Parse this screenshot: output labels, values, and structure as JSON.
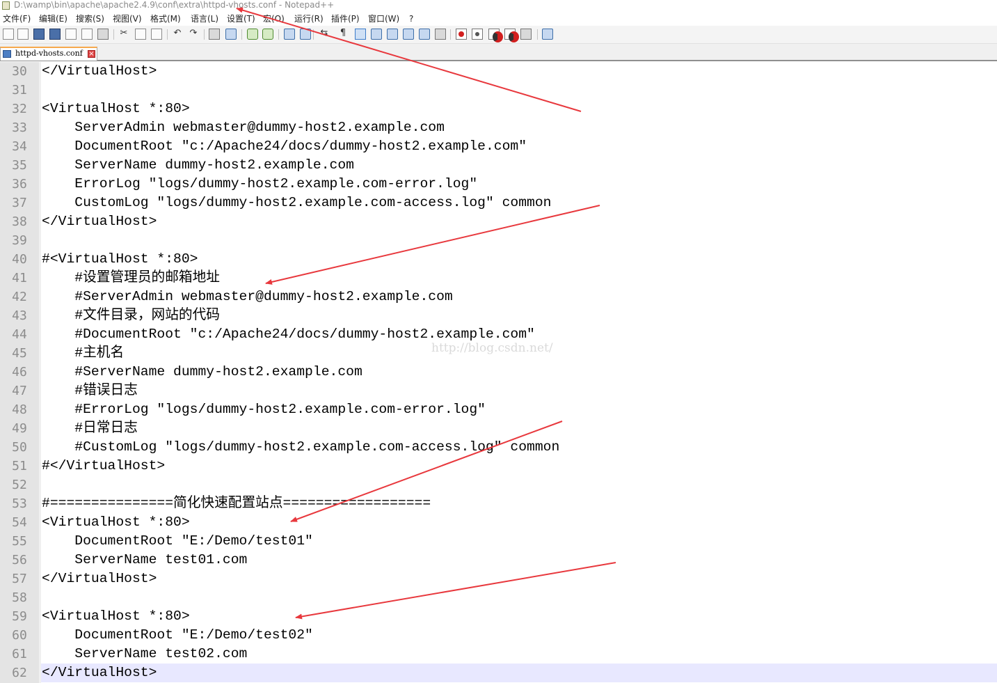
{
  "window": {
    "title": "D:\\wamp\\bin\\apache\\apache2.4.9\\conf\\extra\\httpd-vhosts.conf - Notepad++"
  },
  "menu": [
    {
      "label": "文件(F)"
    },
    {
      "label": "编辑(E)"
    },
    {
      "label": "搜索(S)"
    },
    {
      "label": "视图(V)"
    },
    {
      "label": "格式(M)"
    },
    {
      "label": "语言(L)"
    },
    {
      "label": "设置(T)"
    },
    {
      "label": "宏(O)"
    },
    {
      "label": "运行(R)"
    },
    {
      "label": "插件(P)"
    },
    {
      "label": "窗口(W)"
    },
    {
      "label": "?"
    }
  ],
  "toolbar": {
    "buttons": [
      {
        "name": "new-file",
        "icon": "new-file-icon"
      },
      {
        "name": "open-file",
        "icon": "open-folder-icon"
      },
      {
        "name": "save",
        "icon": "save-icon"
      },
      {
        "name": "save-all",
        "icon": "save-all-icon"
      },
      {
        "name": "close",
        "icon": "close-file-icon"
      },
      {
        "name": "close-all",
        "icon": "close-all-icon"
      },
      {
        "name": "print",
        "icon": "print-icon"
      },
      {
        "name": "cut",
        "icon": "cut-icon"
      },
      {
        "name": "copy",
        "icon": "copy-icon"
      },
      {
        "name": "paste",
        "icon": "paste-icon"
      },
      {
        "name": "undo",
        "icon": "undo-icon"
      },
      {
        "name": "redo",
        "icon": "redo-icon"
      },
      {
        "name": "find",
        "icon": "find-icon"
      },
      {
        "name": "replace",
        "icon": "replace-icon"
      },
      {
        "name": "zoom-in",
        "icon": "zoom-in-icon"
      },
      {
        "name": "zoom-out",
        "icon": "zoom-out-icon"
      },
      {
        "name": "sync-vertical",
        "icon": "sync-vertical-icon"
      },
      {
        "name": "sync-horizontal",
        "icon": "sync-horizontal-icon"
      },
      {
        "name": "word-wrap",
        "icon": "word-wrap-icon"
      },
      {
        "name": "show-all-chars",
        "icon": "pilcrow-icon"
      },
      {
        "name": "indent-guide",
        "icon": "indent-guide-icon"
      },
      {
        "name": "user-language",
        "icon": "user-language-icon"
      },
      {
        "name": "doc-map",
        "icon": "document-map-icon"
      },
      {
        "name": "function-list",
        "icon": "function-list-icon"
      },
      {
        "name": "folder-workspace",
        "icon": "folder-workspace-icon"
      },
      {
        "name": "monitoring",
        "icon": "eye-icon"
      },
      {
        "name": "macro-record",
        "icon": "record-icon"
      },
      {
        "name": "macro-stop",
        "icon": "stop-icon"
      },
      {
        "name": "macro-play",
        "icon": "play-icon"
      },
      {
        "name": "macro-run-multiple",
        "icon": "fast-forward-icon"
      },
      {
        "name": "macro-save",
        "icon": "save-macro-icon"
      },
      {
        "name": "launch-in-browser",
        "icon": "browser-icon"
      }
    ]
  },
  "tab": {
    "label": "httpd-vhosts.conf",
    "close_icon": "close-icon"
  },
  "editor": {
    "current_line": 62,
    "lines": [
      {
        "num": "30",
        "text": "</VirtualHost>"
      },
      {
        "num": "31",
        "text": ""
      },
      {
        "num": "32",
        "text": "<VirtualHost *:80>"
      },
      {
        "num": "33",
        "text": "    ServerAdmin webmaster@dummy-host2.example.com"
      },
      {
        "num": "34",
        "text": "    DocumentRoot \"c:/Apache24/docs/dummy-host2.example.com\""
      },
      {
        "num": "35",
        "text": "    ServerName dummy-host2.example.com"
      },
      {
        "num": "36",
        "text": "    ErrorLog \"logs/dummy-host2.example.com-error.log\""
      },
      {
        "num": "37",
        "text": "    CustomLog \"logs/dummy-host2.example.com-access.log\" common"
      },
      {
        "num": "38",
        "text": "</VirtualHost>"
      },
      {
        "num": "39",
        "text": ""
      },
      {
        "num": "40",
        "text": "#<VirtualHost *:80>"
      },
      {
        "num": "41",
        "text": "    #设置管理员的邮箱地址"
      },
      {
        "num": "42",
        "text": "    #ServerAdmin webmaster@dummy-host2.example.com"
      },
      {
        "num": "43",
        "text": "    #文件目录，网站的代码"
      },
      {
        "num": "44",
        "text": "    #DocumentRoot \"c:/Apache24/docs/dummy-host2.example.com\""
      },
      {
        "num": "45",
        "text": "    #主机名"
      },
      {
        "num": "46",
        "text": "    #ServerName dummy-host2.example.com"
      },
      {
        "num": "47",
        "text": "    #错误日志"
      },
      {
        "num": "48",
        "text": "    #ErrorLog \"logs/dummy-host2.example.com-error.log\""
      },
      {
        "num": "49",
        "text": "    #日常日志"
      },
      {
        "num": "50",
        "text": "    #CustomLog \"logs/dummy-host2.example.com-access.log\" common"
      },
      {
        "num": "51",
        "text": "#</VirtualHost>"
      },
      {
        "num": "52",
        "text": ""
      },
      {
        "num": "53",
        "text": "#===============简化快速配置站点=================="
      },
      {
        "num": "54",
        "text": "<VirtualHost *:80>"
      },
      {
        "num": "55",
        "text": "    DocumentRoot \"E:/Demo/test01\""
      },
      {
        "num": "56",
        "text": "    ServerName test01.com"
      },
      {
        "num": "57",
        "text": "</VirtualHost>"
      },
      {
        "num": "58",
        "text": ""
      },
      {
        "num": "59",
        "text": "<VirtualHost *:80>"
      },
      {
        "num": "60",
        "text": "    DocumentRoot \"E:/Demo/test02\""
      },
      {
        "num": "61",
        "text": "    ServerName test02.com"
      },
      {
        "num": "62",
        "text": "</VirtualHost>"
      }
    ]
  },
  "watermark": "http://blog.csdn.net/",
  "colors": {
    "arrow": "#e8383d",
    "current_line_bg": "#e8e8ff",
    "gutter_bg": "#e4e4e4",
    "line_number": "#8c8c8c",
    "tab_accent": "#f7a94d"
  }
}
